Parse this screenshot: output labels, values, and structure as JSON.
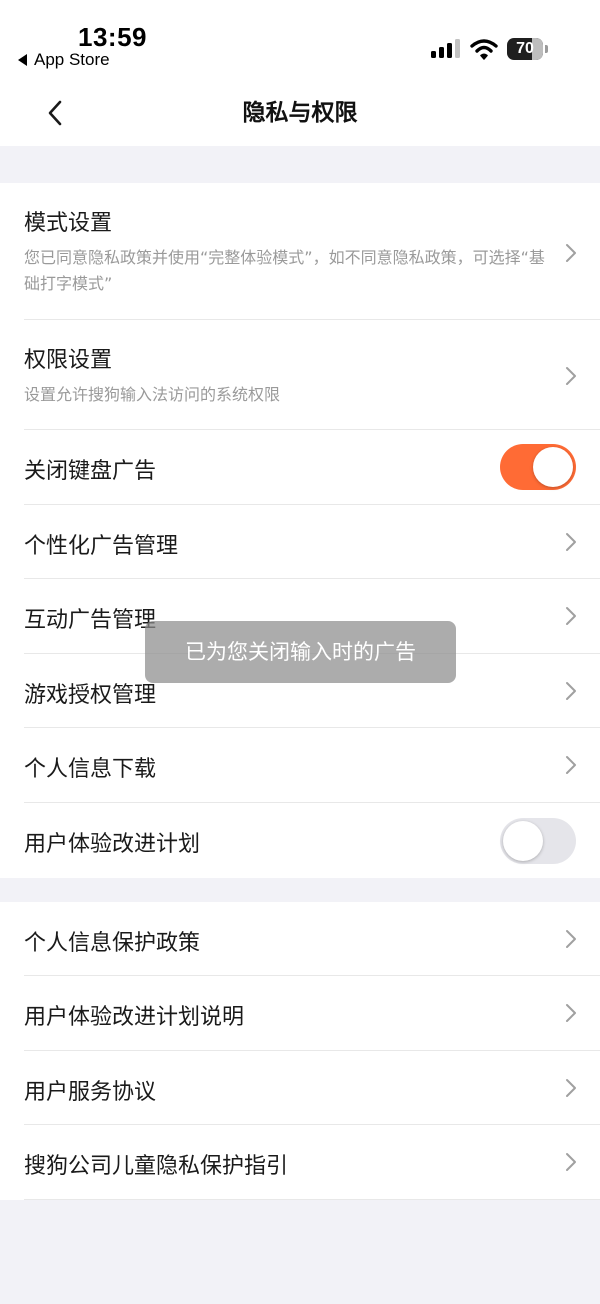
{
  "status_bar": {
    "time": "13:59",
    "back_app": "App Store",
    "battery": 70
  },
  "nav": {
    "title": "隐私与权限"
  },
  "section1": {
    "mode": {
      "label": "模式设置",
      "desc": "您已同意隐私政策并使用“完整体验模式”，如不同意隐私政策，可选择“基础打字模式”"
    },
    "permission": {
      "label": "权限设置",
      "desc": "设置允许搜狗输入法访问的系统权限"
    },
    "close_keyboard_ads": {
      "label": "关闭键盘广告",
      "enabled": true
    },
    "personalized_ads": {
      "label": "个性化广告管理"
    },
    "interactive_ads": {
      "label": "互动广告管理"
    },
    "game_auth": {
      "label": "游戏授权管理"
    },
    "personal_info_download": {
      "label": "个人信息下载"
    },
    "ux_plan": {
      "label": "用户体验改进计划",
      "enabled": false
    }
  },
  "section2": {
    "privacy_policy": {
      "label": "个人信息保护政策"
    },
    "ux_plan_desc": {
      "label": "用户体验改进计划说明"
    },
    "service_agreement": {
      "label": "用户服务协议"
    },
    "child_privacy": {
      "label": "搜狗公司儿童隐私保护指引"
    }
  },
  "toast": {
    "message": "已为您关闭输入时的广告"
  },
  "colors": {
    "accent": "#ff6b35",
    "background": "#f2f2f7",
    "card": "#ffffff",
    "secondary_text": "#9a9a9a"
  }
}
